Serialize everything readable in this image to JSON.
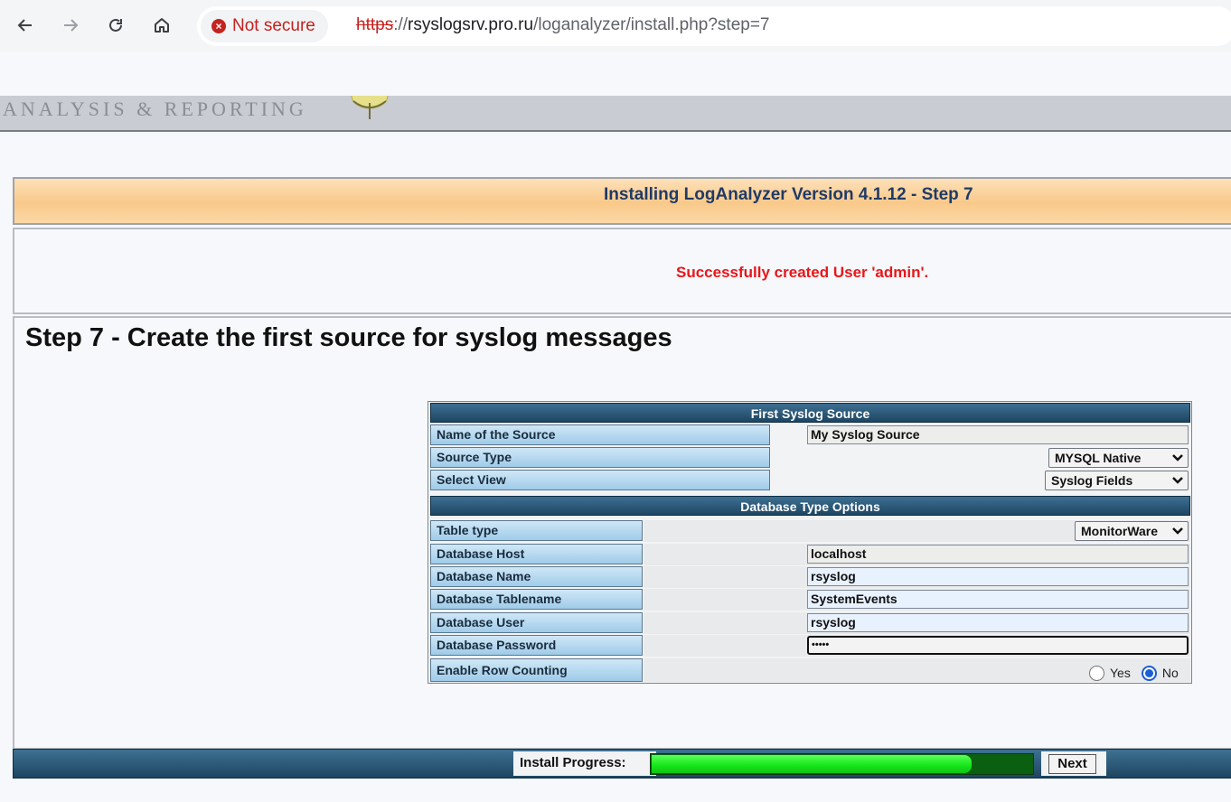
{
  "browser": {
    "security_label": "Not secure",
    "url_scheme": "https",
    "url_sep": "://",
    "url_host": "rsyslogsrv.pro.ru",
    "url_path": "/loganalyzer/install.php?step=7",
    "icons": [
      "back-arrow-icon",
      "forward-arrow-icon",
      "reload-icon",
      "home-icon",
      "not-secure-icon"
    ]
  },
  "banner": {
    "text": "ANALYSIS & REPORTING"
  },
  "title": "Installing LogAnalyzer Version 4.1.12 - Step 7",
  "message": "Successfully created User 'admin'.",
  "heading": "Step 7 - Create the first source for syslog messages",
  "form": {
    "section1": "First Syslog Source",
    "section2": "Database Type Options",
    "source_name_label": "Name of the Source",
    "source_name_value": "My Syslog Source",
    "source_type_label": "Source Type",
    "source_type_value": "MYSQL Native",
    "select_view_label": "Select View",
    "select_view_value": "Syslog Fields",
    "table_type_label": "Table type",
    "table_type_value": "MonitorWare",
    "db_host_label": "Database Host",
    "db_host_value": "localhost",
    "db_name_label": "Database Name",
    "db_name_value": "rsyslog",
    "db_tablename_label": "Database Tablename",
    "db_tablename_value": "SystemEvents",
    "db_user_label": "Database User",
    "db_user_value": "rsyslog",
    "db_password_label": "Database Password",
    "db_password_value": "•••••",
    "row_counting_label": "Enable Row Counting",
    "row_counting_yes": "Yes",
    "row_counting_no": "No",
    "row_counting_selected": "No"
  },
  "footer": {
    "progress_label": "Install Progress:",
    "progress_fraction": 0.84,
    "next_label": "Next"
  },
  "colors": {
    "accent_header": "#1e4662",
    "error_red": "#e8161a",
    "progress_green": "#16e81a"
  }
}
